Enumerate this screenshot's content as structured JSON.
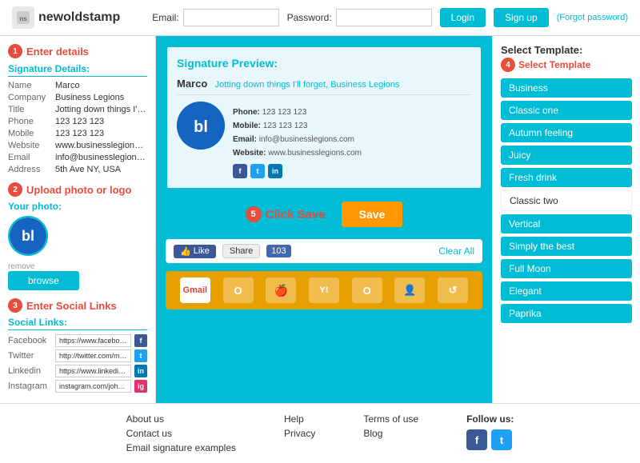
{
  "header": {
    "logo_text": "newoldstamp",
    "email_label": "Email:",
    "password_label": "Password:",
    "email_placeholder": "",
    "password_placeholder": "",
    "login_label": "Login",
    "signup_label": "Sign up",
    "forgot_label": "(Forgot password)"
  },
  "left": {
    "step1_label": "Enter details",
    "signature_details_title": "Signature Details:",
    "fields": [
      {
        "label": "Name",
        "value": "Marco"
      },
      {
        "label": "Company",
        "value": "Business Legions"
      },
      {
        "label": "Title",
        "value": "Jotting down things I'll forget"
      },
      {
        "label": "Phone",
        "value": "123 123 123"
      },
      {
        "label": "Mobile",
        "value": "123 123 123"
      },
      {
        "label": "Website",
        "value": "www.businesslegions.com"
      },
      {
        "label": "Email",
        "value": "info@businesslegions.com"
      },
      {
        "label": "Address",
        "value": "5th Ave NY, USA"
      }
    ],
    "photo_section_title": "Your photo:",
    "step2_label": "Upload photo or logo",
    "avatar_text": "bl",
    "remove_label": "remove",
    "browse_label": "browse",
    "step3_label": "Enter Social Links",
    "social_title": "Social Links:",
    "social_fields": [
      {
        "label": "Facebook",
        "value": "https://www.facebook.com/",
        "icon": "f",
        "type": "fb"
      },
      {
        "label": "Twitter",
        "value": "http://twitter.com/marco_tr...",
        "icon": "t",
        "type": "tw"
      },
      {
        "label": "Linkedin",
        "value": "https://www.linkedin.com/ir...",
        "icon": "in",
        "type": "li"
      },
      {
        "label": "Instagram",
        "value": "instagram.com/johndoe",
        "icon": "ig",
        "type": "ig"
      }
    ]
  },
  "center": {
    "preview_title": "Signature Preview:",
    "sig_name": "Marco",
    "sig_tagline": "Jotting down things I'll forget, Business Legions",
    "sig_avatar": "bl",
    "sig_phone_label": "Phone:",
    "sig_phone": "123 123 123",
    "sig_mobile_label": "Mobile:",
    "sig_mobile": "123 123 123",
    "sig_email_label": "Email:",
    "sig_email": "info@businesslegions.com",
    "sig_website_label": "Website:",
    "sig_website": "www.businesslegions.com",
    "step5_label": "Click Save",
    "save_label": "Save",
    "fb_like": "Like",
    "share": "Share",
    "share_count": "103",
    "clear_all": "Clear All",
    "email_clients": [
      "Gmail",
      "O",
      "🍎",
      "Y!",
      "O",
      "👤",
      "↺"
    ]
  },
  "right": {
    "select_title": "Select Template:",
    "step4_label": "Select Template",
    "templates": [
      {
        "name": "Business",
        "style": "colored"
      },
      {
        "name": "Classic one",
        "style": "colored"
      },
      {
        "name": "Autumn feeling",
        "style": "colored"
      },
      {
        "name": "Juicy",
        "style": "colored"
      },
      {
        "name": "Fresh drink",
        "style": "colored"
      },
      {
        "name": "Classic two",
        "style": "white"
      },
      {
        "name": "Vertical",
        "style": "colored"
      },
      {
        "name": "Simply the best",
        "style": "colored"
      },
      {
        "name": "Full Moon",
        "style": "colored"
      },
      {
        "name": "Elegant",
        "style": "colored"
      },
      {
        "name": "Paprika",
        "style": "colored"
      }
    ]
  },
  "footer": {
    "col1": [
      {
        "label": "About us"
      },
      {
        "label": "Contact us"
      },
      {
        "label": "Email signature examples"
      }
    ],
    "col2": [
      {
        "label": "Help"
      },
      {
        "label": "Privacy"
      }
    ],
    "col3": [
      {
        "label": "Terms of use"
      },
      {
        "label": "Blog"
      }
    ],
    "follow_title": "Follow us:"
  }
}
